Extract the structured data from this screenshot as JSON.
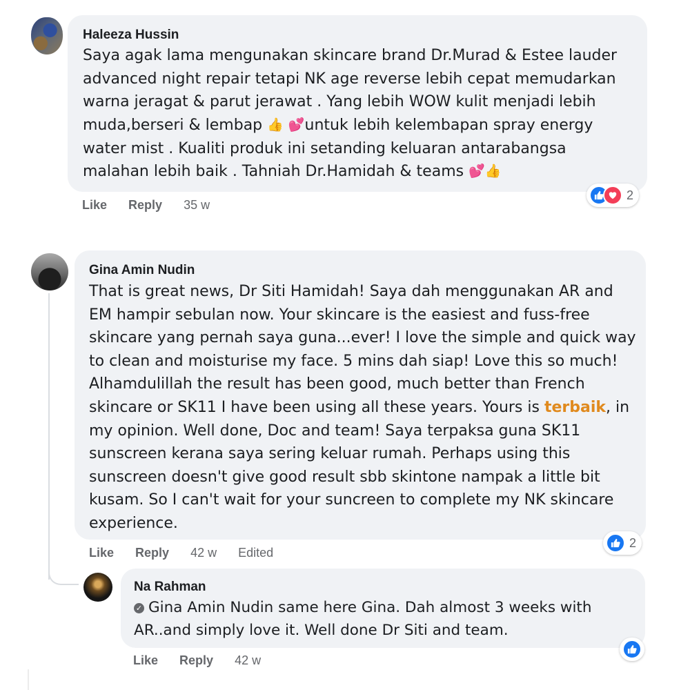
{
  "comments": [
    {
      "author": "Haleeza Hussin",
      "lines": [
        "Saya agak lama mengunakan skincare brand Dr.Murad & Estee lauder",
        "advanced night repair tetapi NK age reverse lebih cepat memudarkan",
        "warna jeragat & parut jerawat . Yang lebih WOW kulit menjadi lebih",
        "muda,berseri & lembap",
        "untuk lebih kelembapan spray energy",
        "water mist . Kualiti produk ini setanding keluaran antarabangsa",
        "malahan lebih baik . Tahniah Dr.Hamidah & teams"
      ],
      "like_label": "Like",
      "reply_label": "Reply",
      "time": "35 w",
      "reaction_count": "2",
      "reactions": [
        "like-icon",
        "love-icon"
      ]
    },
    {
      "author": "Gina Amin Nudin",
      "lines": [
        "That is great news, Dr Siti Hamidah! Saya dah menggunakan AR and",
        "EM hampir sebulan now. Your skincare is the easiest and fuss-free",
        "skincare yang pernah saya guna...ever! I love the simple and quick way",
        "to clean and moisturise my face. 5 mins dah siap! Love this so much!",
        "Alhamdulillah the result has been good, much better than French",
        "skincare or SK11 I have been using all these years. Yours is",
        "terbaik",
        ", in",
        "my opinion. Well done, Doc and team! Saya terpaksa guna SK11",
        "sunscreen kerana saya sering keluar rumah. Perhaps using this",
        "sunscreen doesn't give good result sbb skintone nampak a little bit",
        "kusam. So I can't wait for your suncreen to complete my NK skincare",
        "experience."
      ],
      "like_label": "Like",
      "reply_label": "Reply",
      "time": "42 w",
      "edited_label": "Edited",
      "reaction_count": "2",
      "reactions": [
        "like-icon"
      ],
      "highlight_color": "#e08a1e"
    },
    {
      "author": "Na Rahman",
      "mention": "Gina Amin Nudin",
      "lines": [
        "same here Gina. Dah almost 3 weeks with",
        "AR..and simply love it. Well done Dr Siti and team."
      ],
      "like_label": "Like",
      "reply_label": "Reply",
      "time": "42 w",
      "reactions": [
        "like-icon"
      ]
    }
  ],
  "colors": {
    "bubble": "#f0f2f5",
    "like_blue": "#1877f2",
    "love_red": "#f33e58",
    "meta_gray": "#65676b"
  }
}
